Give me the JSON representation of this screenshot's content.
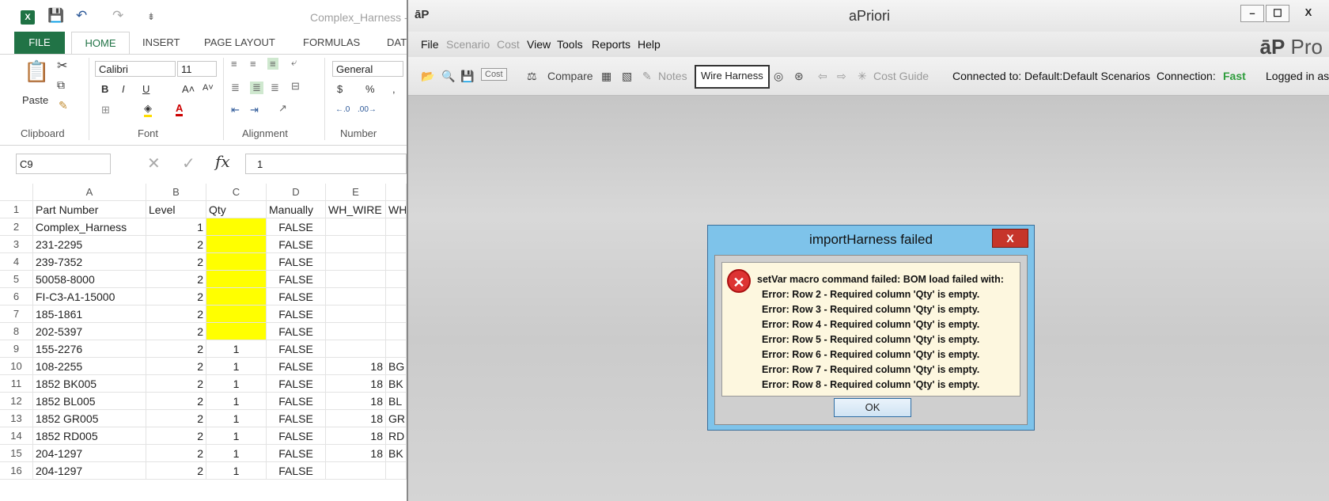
{
  "excel": {
    "window_title": "Complex_Harness -",
    "tabs": [
      "FILE",
      "HOME",
      "INSERT",
      "PAGE LAYOUT",
      "FORMULAS",
      "DAT"
    ],
    "ribbon": {
      "paste": "Paste",
      "font_name": "Calibri",
      "font_size": "11",
      "number_format": "General",
      "groups": [
        "Clipboard",
        "Font",
        "Alignment",
        "Number"
      ]
    },
    "name_box": "C9",
    "formula": "1",
    "columns": [
      "A",
      "B",
      "C",
      "D",
      "E",
      ""
    ],
    "rows": [
      [
        "1",
        "Part Number",
        "Level",
        "Qty",
        "Manually",
        "WH_WIRE",
        "WH"
      ],
      [
        "2",
        "Complex_Harness",
        "1",
        "",
        "FALSE",
        "",
        ""
      ],
      [
        "3",
        "231-2295",
        "2",
        "",
        "FALSE",
        "",
        ""
      ],
      [
        "4",
        "239-7352",
        "2",
        "",
        "FALSE",
        "",
        ""
      ],
      [
        "5",
        "50058-8000",
        "2",
        "",
        "FALSE",
        "",
        ""
      ],
      [
        "6",
        "FI-C3-A1-15000",
        "2",
        "",
        "FALSE",
        "",
        ""
      ],
      [
        "7",
        "185-1861",
        "2",
        "",
        "FALSE",
        "",
        ""
      ],
      [
        "8",
        "202-5397",
        "2",
        "",
        "FALSE",
        "",
        ""
      ],
      [
        "9",
        "155-2276",
        "2",
        "1",
        "FALSE",
        "",
        ""
      ],
      [
        "10",
        "108-2255",
        "2",
        "1",
        "FALSE",
        "18",
        "BG"
      ],
      [
        "11",
        "1852 BK005",
        "2",
        "1",
        "FALSE",
        "18",
        "BK"
      ],
      [
        "12",
        "1852 BL005",
        "2",
        "1",
        "FALSE",
        "18",
        "BL"
      ],
      [
        "13",
        "1852 GR005",
        "2",
        "1",
        "FALSE",
        "18",
        "GR"
      ],
      [
        "14",
        "1852 RD005",
        "2",
        "1",
        "FALSE",
        "18",
        "RD"
      ],
      [
        "15",
        "204-1297",
        "2",
        "1",
        "FALSE",
        "18",
        "BK"
      ],
      [
        "16",
        "204-1297",
        "2",
        "1",
        "FALSE",
        "",
        ""
      ]
    ]
  },
  "apriori": {
    "logo": "āP",
    "title": "aPriori",
    "window_buttons": [
      "–",
      "☐",
      "X"
    ],
    "menu": [
      "File",
      "Scenario",
      "Cost",
      "View",
      "Tools",
      "Reports",
      "Help"
    ],
    "brand_bold": "āP",
    "brand_text": " Pro",
    "toolbar": {
      "cost": "Cost",
      "compare": "Compare",
      "notes": "Notes",
      "wire_harness": "Wire Harness",
      "cost_guide": "Cost Guide",
      "connected_to": "Connected to: Default:Default Scenarios",
      "connection_label": "Connection:",
      "connection_value": "Fast",
      "logged_in": "Logged in as:"
    },
    "dialog": {
      "title": "importHarness failed",
      "close": "X",
      "lines": [
        "setVar macro command failed: BOM load failed with:",
        "Error: Row 2 - Required column 'Qty' is empty.",
        "Error: Row 3 - Required column 'Qty' is empty.",
        "Error: Row 4 - Required column 'Qty' is empty.",
        "Error: Row 5 - Required column 'Qty' is empty.",
        "Error: Row 6 - Required column 'Qty' is empty.",
        "Error: Row 7 - Required column 'Qty' is empty.",
        "Error: Row 8 - Required column 'Qty' is empty."
      ],
      "ok": "OK"
    }
  },
  "colors": {
    "excel_green": "#217346",
    "highlight": "#ffff00",
    "fast": "#2e9d3c",
    "dialog_frame": "#7ec3ea"
  }
}
